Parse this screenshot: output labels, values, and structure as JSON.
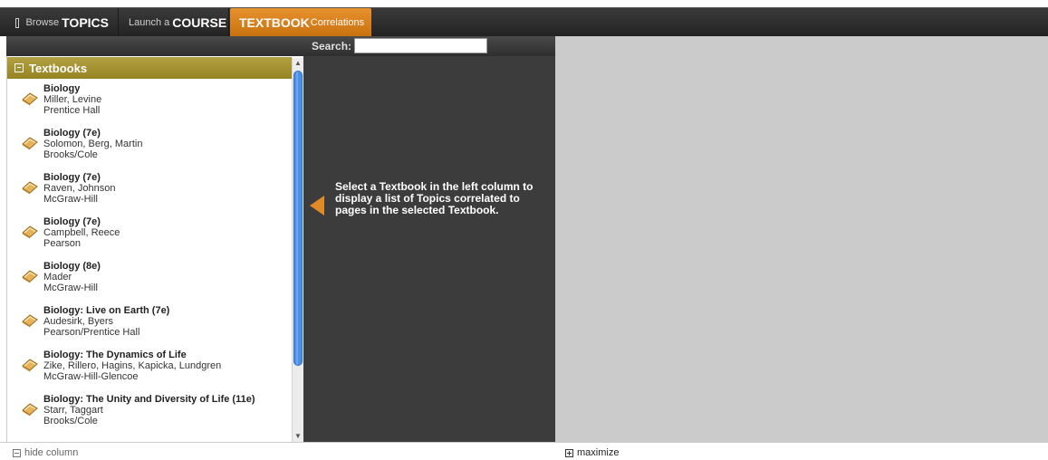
{
  "nav": {
    "browse": {
      "small": "Browse",
      "big": "TOPICS"
    },
    "launch": {
      "small": "Launch a",
      "big": "COURSE"
    },
    "textbook": {
      "big": "TEXTBOOK",
      "small": "Correlations"
    }
  },
  "search": {
    "label": "Search:",
    "value": ""
  },
  "left": {
    "header": "Textbooks",
    "books": [
      {
        "title": "Biology",
        "authors": "Miller, Levine",
        "publisher": "Prentice Hall"
      },
      {
        "title": "Biology  (7e)",
        "authors": "Solomon, Berg, Martin",
        "publisher": "Brooks/Cole"
      },
      {
        "title": "Biology  (7e)",
        "authors": "Raven, Johnson",
        "publisher": "McGraw-Hill"
      },
      {
        "title": "Biology  (7e)",
        "authors": "Campbell, Reece",
        "publisher": "Pearson"
      },
      {
        "title": "Biology  (8e)",
        "authors": "Mader",
        "publisher": "McGraw-Hill"
      },
      {
        "title": "Biology: Live on Earth  (7e)",
        "authors": "Audesirk, Byers",
        "publisher": "Pearson/Prentice Hall"
      },
      {
        "title": "Biology: The Dynamics of Life",
        "authors": "Zike, Rillero, Hagins, Kapicka, Lundgren",
        "publisher": "McGraw-Hill-Glencoe"
      },
      {
        "title": "Biology: The Unity and Diversity of Life  (11e)",
        "authors": "Starr, Taggart",
        "publisher": "Brooks/Cole"
      }
    ]
  },
  "middle": {
    "message": "Select a Textbook in the left column to display a list of Topics correlated to pages in the selected Textbook."
  },
  "bottom": {
    "hide_column": "hide column",
    "maximize": "maximize"
  },
  "colors": {
    "accent_orange": "#e08a28",
    "header_olive": "#a8962f",
    "panel_dark": "#3c3c3c",
    "panel_gray": "#cbcbcb"
  }
}
